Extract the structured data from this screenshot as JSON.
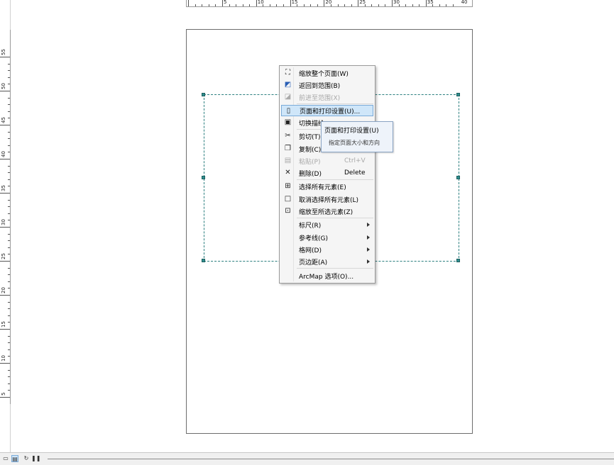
{
  "ruler_top": {
    "labels": [
      "5",
      "10",
      "15",
      "20",
      "25",
      "30",
      "35",
      "40"
    ]
  },
  "ruler_left": {
    "labels": [
      "55",
      "50",
      "45",
      "40",
      "35",
      "30",
      "25",
      "20",
      "15",
      "10",
      "5"
    ]
  },
  "context_menu": {
    "items": [
      {
        "icon": "zoom-whole-page-icon",
        "label": "缩放整个页面(W)",
        "shortcut": "",
        "disabled": false,
        "submenu": false
      },
      {
        "icon": "go-back-to-extent-icon",
        "label": "返回到范围(B)",
        "shortcut": "",
        "disabled": false,
        "submenu": false
      },
      {
        "icon": "go-forward-to-extent-icon",
        "label": "前进至范围(X)",
        "shortcut": "",
        "disabled": true,
        "submenu": false
      },
      {
        "icon": "page-and-print-setup-icon",
        "label": "页面和打印设置(U)...",
        "shortcut": "",
        "disabled": false,
        "submenu": false,
        "highlighted": true
      },
      {
        "icon": "toggle-draft-mode-icon",
        "label": "切换描绘",
        "shortcut": "",
        "disabled": false,
        "submenu": false
      },
      {
        "icon": "scissors-icon",
        "label": "剪切(T)",
        "shortcut": "",
        "disabled": false,
        "submenu": false
      },
      {
        "icon": "copy-icon",
        "label": "复制(C)",
        "shortcut": "",
        "disabled": false,
        "submenu": false
      },
      {
        "icon": "paste-icon",
        "label": "粘贴(P)",
        "shortcut": "Ctrl+V",
        "disabled": true,
        "submenu": false
      },
      {
        "icon": "delete-x-icon",
        "label": "删除(D)",
        "shortcut": "Delete",
        "disabled": false,
        "submenu": false
      },
      {
        "icon": "select-all-elements-icon",
        "label": "选择所有元素(E)",
        "shortcut": "",
        "disabled": false,
        "submenu": false
      },
      {
        "icon": "unselect-all-elements-icon",
        "label": "取消选择所有元素(L)",
        "shortcut": "",
        "disabled": false,
        "submenu": false
      },
      {
        "icon": "zoom-to-selected-elements-icon",
        "label": "缩放至所选元素(Z)",
        "shortcut": "",
        "disabled": false,
        "submenu": false
      },
      {
        "icon": "",
        "label": "标尺(R)",
        "shortcut": "",
        "disabled": false,
        "submenu": true
      },
      {
        "icon": "",
        "label": "参考线(G)",
        "shortcut": "",
        "disabled": false,
        "submenu": true
      },
      {
        "icon": "",
        "label": "格网(D)",
        "shortcut": "",
        "disabled": false,
        "submenu": true
      },
      {
        "icon": "",
        "label": "页边距(A)",
        "shortcut": "",
        "disabled": false,
        "submenu": true
      },
      {
        "icon": "",
        "label": "ArcMap 选项(O)...",
        "shortcut": "",
        "disabled": false,
        "submenu": false
      }
    ]
  },
  "tooltip": {
    "title": "页面和打印设置(U)",
    "description": "指定页面大小和方向"
  },
  "statusbar": {
    "buttons": [
      "data-view-icon",
      "layout-view-icon",
      "refresh-icon",
      "pause-icon"
    ]
  },
  "colors": {
    "selection_frame": "#2b7f7f",
    "menu_highlight": "#cfe6f9",
    "menu_highlight_border": "#7aabd9"
  }
}
